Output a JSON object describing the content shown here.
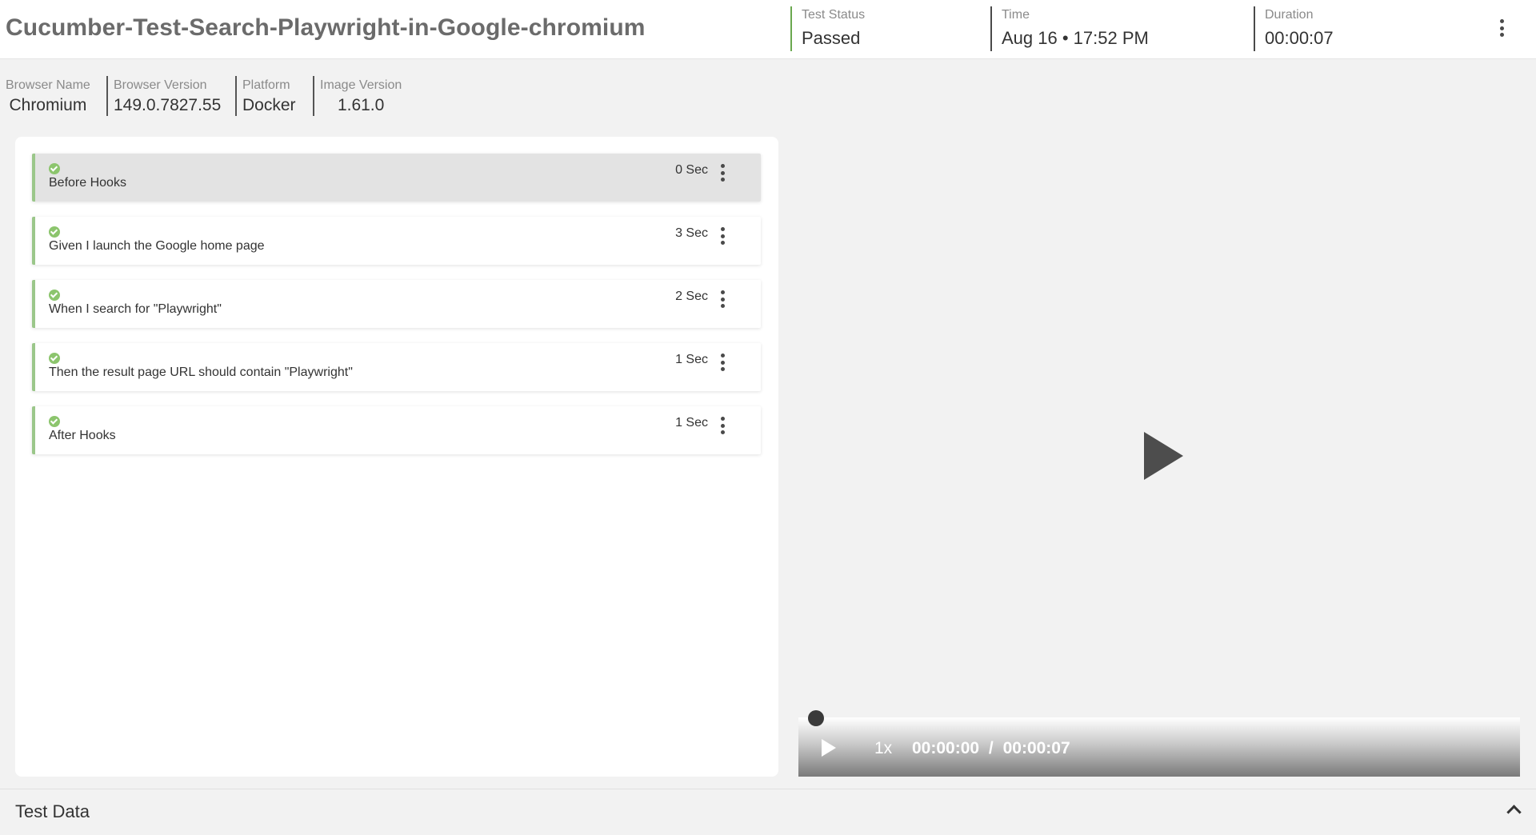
{
  "header": {
    "title": "Cucumber-Test-Search-Playwright-in-Google-chromium",
    "status_label": "Test Status",
    "status_value": "Passed",
    "time_label": "Time",
    "time_value": "Aug 16 • 17:52 PM",
    "duration_label": "Duration",
    "duration_value": "00:00:07",
    "menu_icon": "more-vertical-icon"
  },
  "meta": {
    "browser_name_label": "Browser Name",
    "browser_name_value": "Chromium",
    "browser_version_label": "Browser Version",
    "browser_version_value": "149.0.7827.55",
    "platform_label": "Platform",
    "platform_value": "Docker",
    "image_version_label": "Image Version",
    "image_version_value": "1.61.0"
  },
  "steps": [
    {
      "name": "Before Hooks",
      "duration": "0 Sec",
      "status": "passed"
    },
    {
      "name": "Given I launch the Google home page",
      "duration": "3 Sec",
      "status": "passed"
    },
    {
      "name": "When I search for \"Playwright\"",
      "duration": "2 Sec",
      "status": "passed"
    },
    {
      "name": "Then the result page URL should contain \"Playwright\"",
      "duration": "1 Sec",
      "status": "passed"
    },
    {
      "name": "After Hooks",
      "duration": "1 Sec",
      "status": "passed"
    }
  ],
  "player": {
    "speed": "1x",
    "current_time": "00:00:00",
    "separator": "/",
    "total_time": "00:00:07",
    "progress": 0
  },
  "test_data": {
    "title": "Test Data"
  },
  "colors": {
    "passed": "#8cc56d",
    "step_border": "#9bc78a",
    "active_step_bg": "#e3e3e3"
  }
}
